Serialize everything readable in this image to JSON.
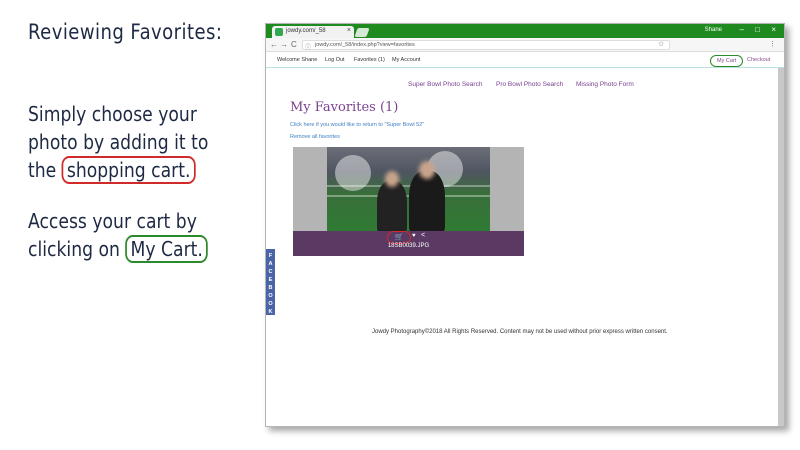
{
  "slide": {
    "title": "Reviewing Favorites:",
    "para1_line1": "Simply choose your",
    "para1_line2": "photo by adding it to",
    "para1_line3_pre": "the",
    "para1_line3_hl": "shopping cart.",
    "para2_line1": "Access your cart by",
    "para2_line2_pre": "clicking on",
    "para2_line2_hl": "My Cart."
  },
  "browser": {
    "tab_title": "jowdy.com/_58",
    "tab_close": "×",
    "user": "Shane",
    "min": "–",
    "max": "□",
    "close": "×",
    "back": "←",
    "forward": "→",
    "reload": "C",
    "info": "ⓘ",
    "url": "jowdy.com/_58/index.php?view=favorites",
    "star": "☆",
    "menu": "⋮"
  },
  "nav": {
    "welcome": "Welcome Shane",
    "logout": "Log Out",
    "favorites": "Favorites (1)",
    "account": "My Account",
    "cart": "My Cart",
    "checkout": "Checkout"
  },
  "page": {
    "link1": "Super Bowl Photo Search",
    "link2": "Pro Bowl Photo Search",
    "link3": "Missing Photo Form",
    "title": "My Favorites (1)",
    "return_link": "Click here if you would like to return to \"Super Bowl 52\"",
    "remove_all": "Remove all favorites",
    "photo_filename": "18SB0039.JPG",
    "footer": "Jowdy Photography©2018 All Rights Reserved. Content may not be used without prior express written consent.",
    "facebook_tab": "FACEBOOK",
    "cart_glyph": "🛒",
    "heart_glyph": "♥",
    "share_glyph": "<"
  },
  "colors": {
    "accent_purple": "#7a4090",
    "chrome_green": "#1f8a1f",
    "highlight_red": "#d12a2a",
    "highlight_green": "#2b8a2b"
  }
}
